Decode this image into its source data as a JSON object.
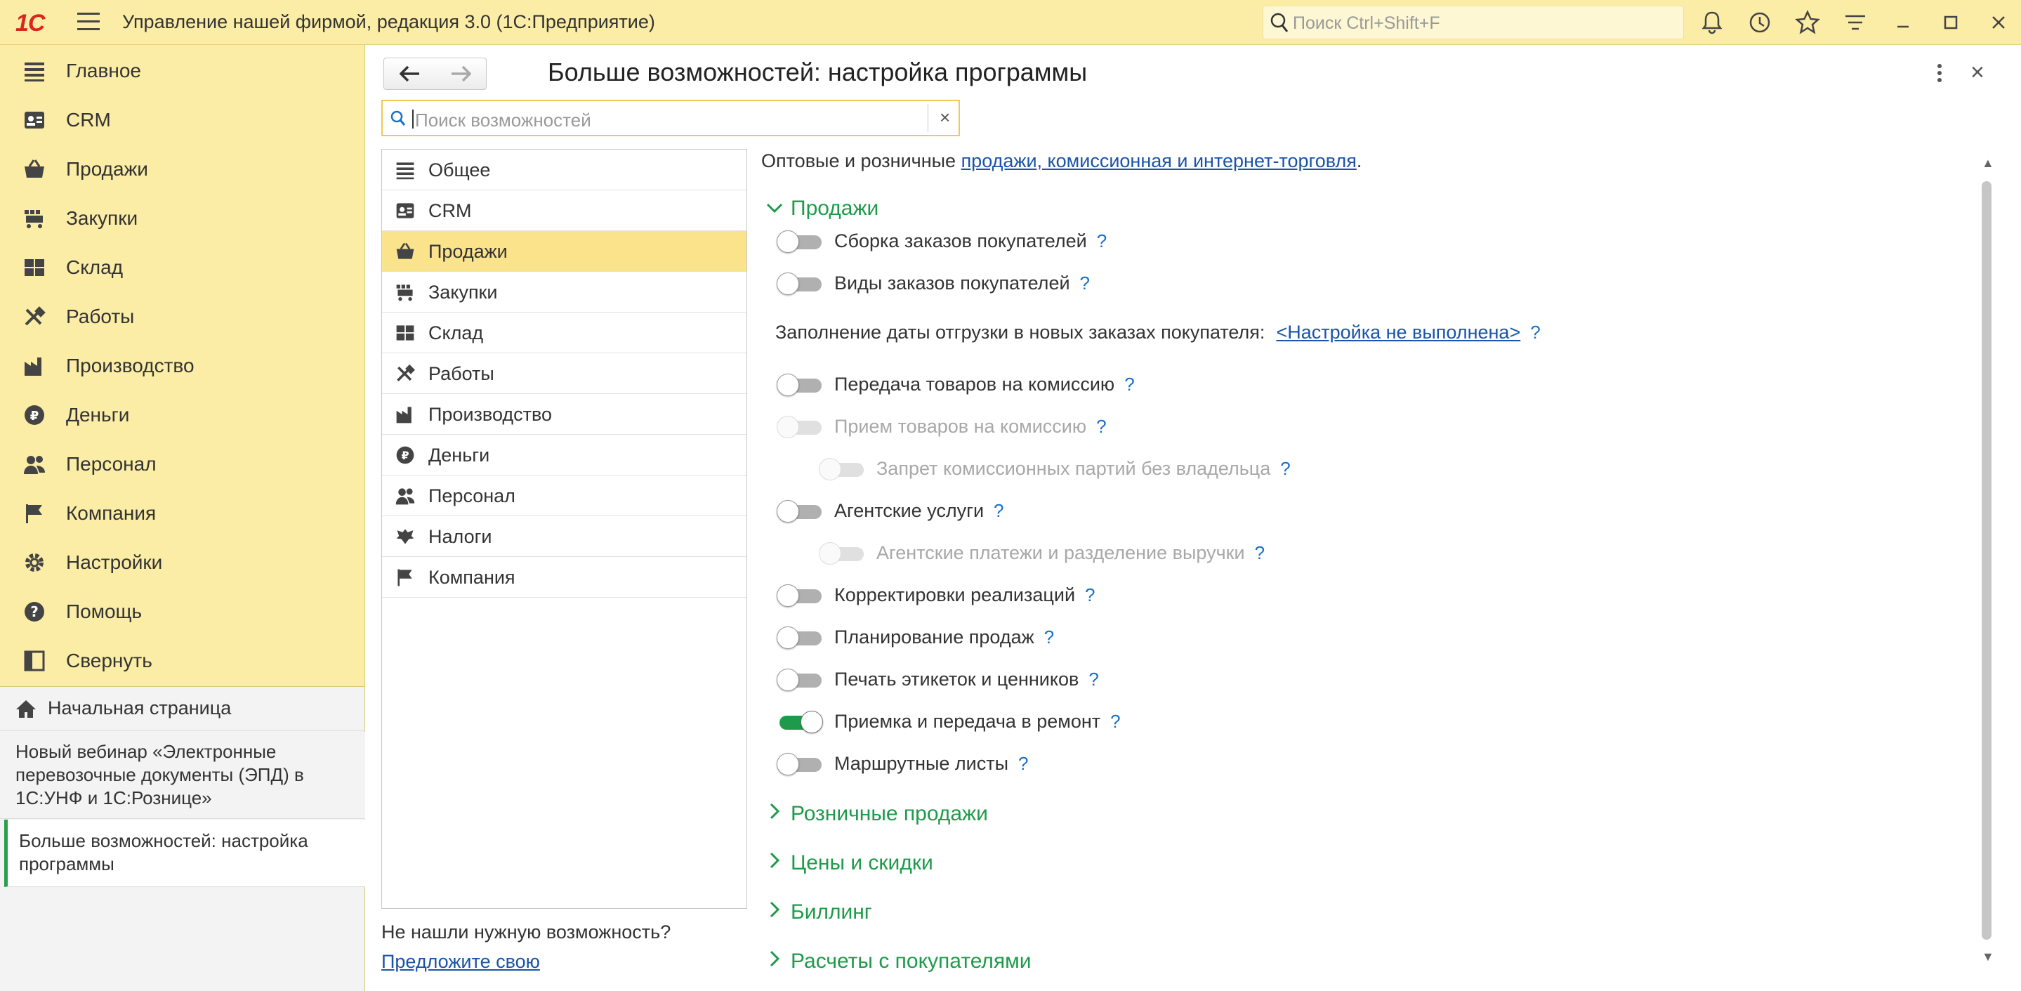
{
  "app": {
    "logo": "1С",
    "title": "Управление нашей фирмой, редакция 3.0  (1С:Предприятие)",
    "search_placeholder": "Поиск Ctrl+Shift+F"
  },
  "sidebar": {
    "items": [
      {
        "label": "Главное",
        "icon": "list-icon"
      },
      {
        "label": "CRM",
        "icon": "crm-icon"
      },
      {
        "label": "Продажи",
        "icon": "basket-icon"
      },
      {
        "label": "Закупки",
        "icon": "cart-icon"
      },
      {
        "label": "Склад",
        "icon": "warehouse-icon"
      },
      {
        "label": "Работы",
        "icon": "tools-icon"
      },
      {
        "label": "Производство",
        "icon": "factory-icon"
      },
      {
        "label": "Деньги",
        "icon": "ruble-icon"
      },
      {
        "label": "Персонал",
        "icon": "people-icon"
      },
      {
        "label": "Компания",
        "icon": "flag-icon"
      },
      {
        "label": "Настройки",
        "icon": "gear-icon"
      },
      {
        "label": "Помощь",
        "icon": "help-icon"
      },
      {
        "label": "Свернуть",
        "icon": "collapse-icon"
      }
    ],
    "home": "Начальная страница",
    "webinar": "Новый вебинар «Электронные перевозочные документы (ЭПД) в 1С:УНФ и 1С:Рознице»",
    "current": "Больше возможностей: настройка программы"
  },
  "main": {
    "title": "Больше возможностей: настройка программы",
    "search_placeholder": "Поиск возможностей",
    "categories": [
      {
        "label": "Общее",
        "icon": "list-icon"
      },
      {
        "label": "CRM",
        "icon": "crm-icon"
      },
      {
        "label": "Продажи",
        "icon": "basket-icon",
        "active": true
      },
      {
        "label": "Закупки",
        "icon": "cart-icon"
      },
      {
        "label": "Склад",
        "icon": "warehouse-icon"
      },
      {
        "label": "Работы",
        "icon": "tools-icon"
      },
      {
        "label": "Производство",
        "icon": "factory-icon"
      },
      {
        "label": "Деньги",
        "icon": "ruble-icon"
      },
      {
        "label": "Персонал",
        "icon": "people-icon"
      },
      {
        "label": "Налоги",
        "icon": "eagle-icon"
      },
      {
        "label": "Компания",
        "icon": "flag-icon"
      }
    ],
    "not_found": "Не нашли нужную возможность?",
    "suggest": "Предложите свою",
    "intro_text": "Оптовые и розничные ",
    "intro_link": "продажи, комиссионная и интернет-торговля",
    "intro_end": ".",
    "sections": {
      "sales": "Продажи",
      "retail": "Розничные продажи",
      "prices": "Цены и скидки",
      "billing": "Биллинг",
      "settlements": "Расчеты с покупателями"
    },
    "options": [
      {
        "label": "Сборка заказов покупателей",
        "on": false,
        "disabled": false
      },
      {
        "label": "Виды заказов покупателей",
        "on": false,
        "disabled": false
      },
      {
        "label": "Передача товаров на комиссию",
        "on": false,
        "disabled": false
      },
      {
        "label": "Прием товаров на комиссию",
        "on": false,
        "disabled": true
      },
      {
        "label": "Запрет комиссионных партий без владельца",
        "on": false,
        "disabled": true
      },
      {
        "label": "Агентские услуги",
        "on": false,
        "disabled": false
      },
      {
        "label": "Агентские платежи и разделение выручки",
        "on": false,
        "disabled": true
      },
      {
        "label": "Корректировки реализаций",
        "on": false,
        "disabled": false
      },
      {
        "label": "Планирование продаж",
        "on": false,
        "disabled": false
      },
      {
        "label": "Печать этикеток и ценников",
        "on": false,
        "disabled": false
      },
      {
        "label": "Приемка и передача в ремонт",
        "on": true,
        "disabled": false
      },
      {
        "label": "Маршрутные листы",
        "on": false,
        "disabled": false
      }
    ],
    "fill_date_label": "Заполнение даты отгрузки в новых заказах покупателя:",
    "fill_date_link": "<Настройка не выполнена>",
    "help_mark": "?"
  }
}
